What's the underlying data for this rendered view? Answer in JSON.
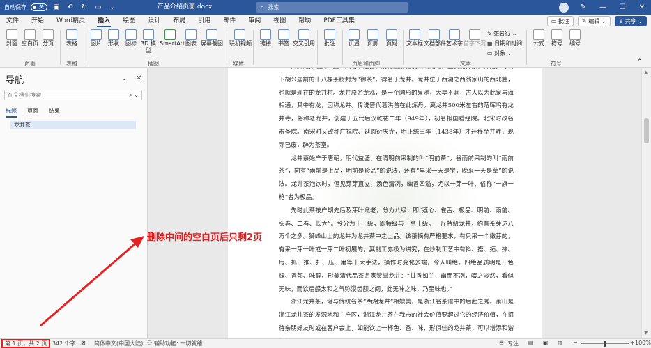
{
  "titlebar": {
    "autosave_label": "自动保存",
    "autosave_state": "关",
    "doc_title": "产品介绍页面.docx",
    "search_placeholder": "搜索"
  },
  "menu": {
    "tabs": [
      "文件",
      "开始",
      "Word精灵",
      "插入",
      "绘图",
      "设计",
      "布局",
      "引用",
      "邮件",
      "审阅",
      "视图",
      "帮助",
      "PDF工具集"
    ],
    "active_tab": "插入",
    "comment_btn": "批注",
    "edit_btn": "编辑",
    "share_btn": "共享"
  },
  "ribbon": {
    "buttons": {
      "cover": "封面",
      "blank_page": "空白页",
      "page_break": "分页",
      "table": "表格",
      "picture": "图片",
      "shape": "形状",
      "icon": "图标",
      "model_3d": "3D 模",
      "model_3d_sub": "型",
      "smartart": "SmartArt",
      "chart": "图表",
      "screenshot": "屏幕截图",
      "online_video": "联机视频",
      "link": "链接",
      "bookmark": "书签",
      "cross_ref": "交叉引用",
      "comment": "批注",
      "header": "页眉",
      "footer": "页脚",
      "page_number": "页码",
      "textbox": "文本框",
      "doc_parts": "文档部件",
      "wordart": "艺术字",
      "dropcap": "首字下沉",
      "signature_line": "签名行",
      "date_time": "日期和时间",
      "object": "对象",
      "equation": "公式",
      "symbol": "符号",
      "numbering": "编号"
    },
    "groups": {
      "pages": "页面",
      "tables": "表格",
      "illustrations": "插图",
      "media": "媒体",
      "header_footer": "页眉和页脚",
      "text": "文本",
      "symbols": "符号"
    }
  },
  "nav": {
    "title": "导航",
    "search_placeholder": "在文档中搜索",
    "tabs": [
      "标题",
      "页面",
      "结果"
    ],
    "active_tab": "标题",
    "heading_item": "龙井茶"
  },
  "document": {
    "paragraphs": [
      "西湖龙井位列中国十大名茶之首，清乾隆游览杭州西湖时，盛赞龙井茶，并把狮峰山下胡公庙前的十八棵茶树封为“御茶”。得名于龙井。龙井位于西湖之西翁家山的西北麓，也就是现在的龙井村。龙井原名龙泓，是一个圆形的泉池，大旱不涸，古人以为此泉与海相通，其中有龙，因称龙井。传说晋代葛洪曾在此炼丹。离龙井500米左右的落晖坞有龙井寺，俗称老龙井，创建于五代后汉乾祐二年（949年），初名报国看经院。北宋时改名寿圣院。南宋时又改称广福院、延恩衍庆寺，明正统三年（1438年）才迁移至井畔，现寺已废，辟为茶室。",
      "龙井茶始产于唐朝，明代益盛，在清明前采制的叫“明前茶”，谷雨前采制的叫“雨前茶”，向有“雨前是上品，明前是珍品”的说法，还有“早采一天是宝，晚采一天是草”的说法。龙井茶泡饮时，但见芽芽直立，汤色清冽，幽香四溢，尤以一芽一叶、俗称“一旗一枪”者为极品。",
      "先时此茶按产期先后及芽叶嫩老，分为八级，即“莲心、雀舌、极品、明前、雨前、头春、二春、长大”。今分为十一级，即特级与一至十级。一斤特级龙井，约有茶芽达八万个之多。狮峰山上的龙井为龙井茶中之上品。该茶摘有严格要求，有只采一个嫩芽的，有采一芽一叶或一芽二叶初展的，其制工亦极为讲究，在炒制工艺中有抖、搭、拓、捺、甩、抓、推、扣、压、磨等十大手法，操作时变化多端，令人叫绝。四绝品质明是：色绿、香郁、味醇、形美清代品茶名家赞誉龙井：“甘香如兰，幽而不冽，啜之淡然，看似无味，而饮后感太和之气弥漫齿额之间，此无味之味，乃至味也。”",
      "浙江龙井茶，堪与传统名茶“西湖龙井”相媲美，是浙江名茶谱中的后起之秀。萧山是浙江龙井茶的发源地和主产区，浙江龙井茶在我市的社会价值要超过它的经济价值，在招待亲朋好友时或在客户会上，如能饮上一杯色、香、味、形俱佳的龙井茶，可以增添和谐气氛。"
    ]
  },
  "annotation": {
    "text": "删除中间的空白页后只剩2页"
  },
  "statusbar": {
    "page_info": "第 1 页，共 2 页",
    "word_count": "342 个字",
    "language": "简体中文(中国大陆)",
    "accessibility": "辅助功能: 一切就绪",
    "focus": "专注",
    "zoom": "100%"
  }
}
